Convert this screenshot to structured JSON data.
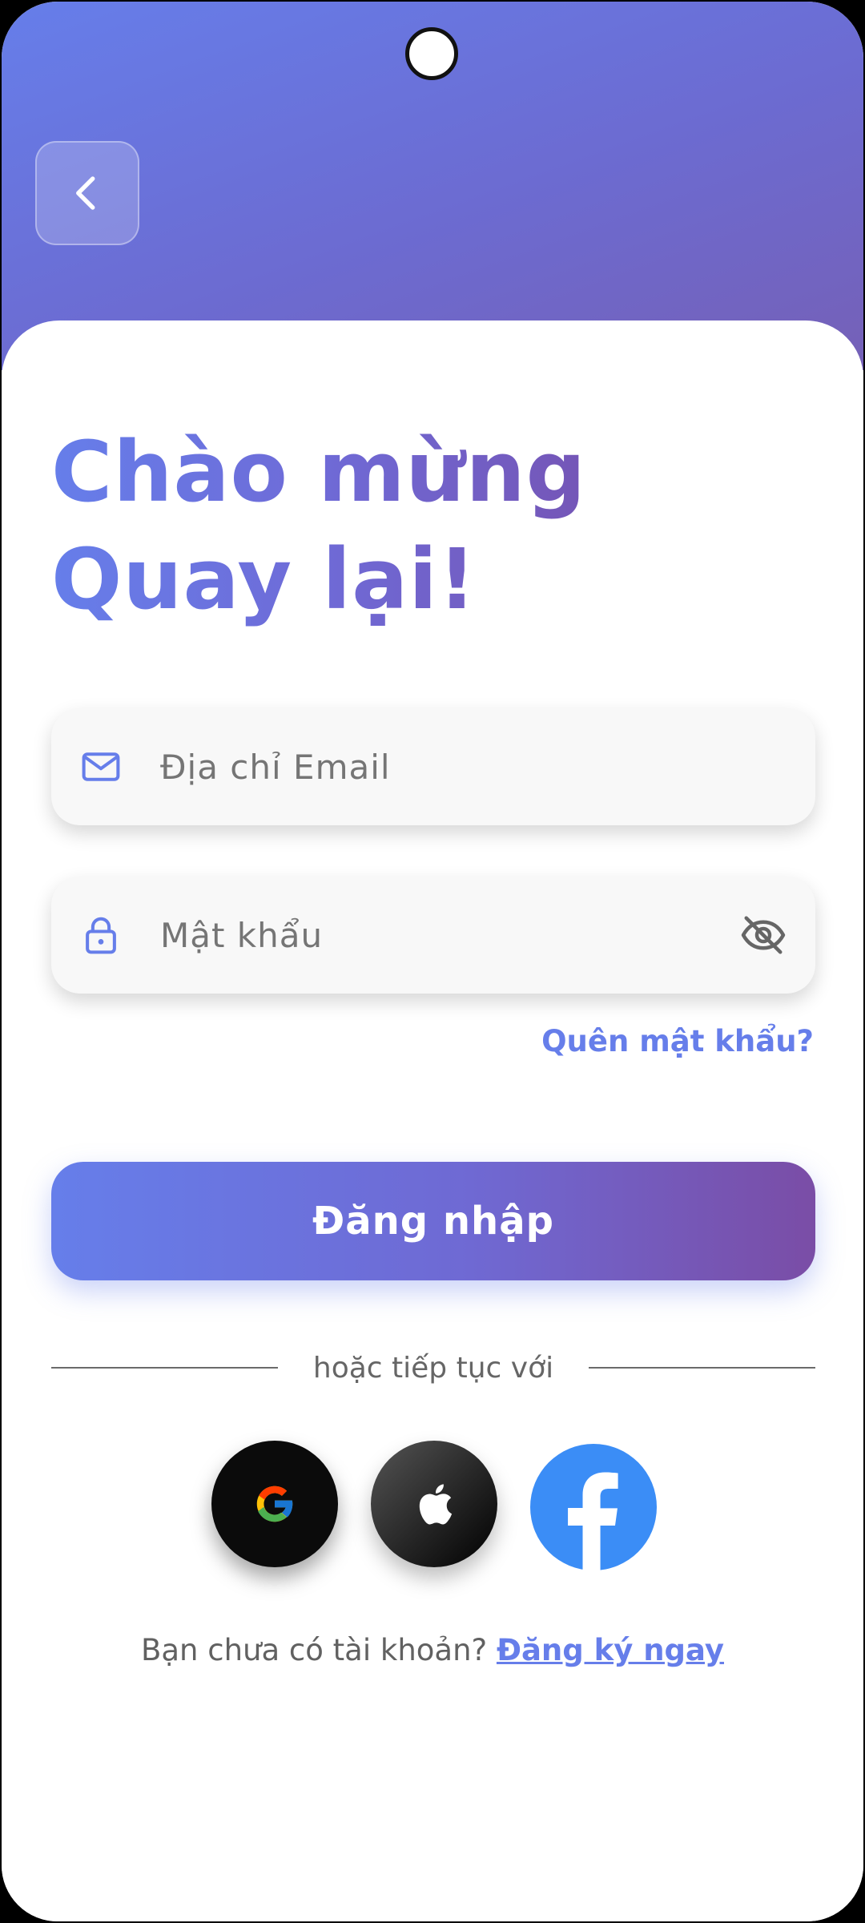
{
  "header": {
    "back_icon": "chevron-left-icon"
  },
  "title": {
    "line1": "Chào mừng",
    "line2": "Quay lại!"
  },
  "form": {
    "email": {
      "icon": "mail-icon",
      "placeholder": "Địa chỉ Email"
    },
    "password": {
      "icon": "lock-icon",
      "placeholder": "Mật khẩu",
      "toggle_icon": "eye-off-icon"
    },
    "forgot_label": "Quên mật khẩu?",
    "login_label": "Đăng nhập"
  },
  "divider": {
    "text": "hoặc tiếp tục với"
  },
  "social": [
    {
      "name": "google",
      "icon": "google-icon"
    },
    {
      "name": "apple",
      "icon": "apple-icon"
    },
    {
      "name": "facebook",
      "icon": "facebook-icon"
    }
  ],
  "footer": {
    "question": "Bạn chưa có tài khoản?",
    "signup_label": "Đăng ký ngay"
  },
  "colors": {
    "accent": "#667eea",
    "accent_end": "#764ba2",
    "field_bg": "#f8f8f8",
    "placeholder": "#757575"
  }
}
